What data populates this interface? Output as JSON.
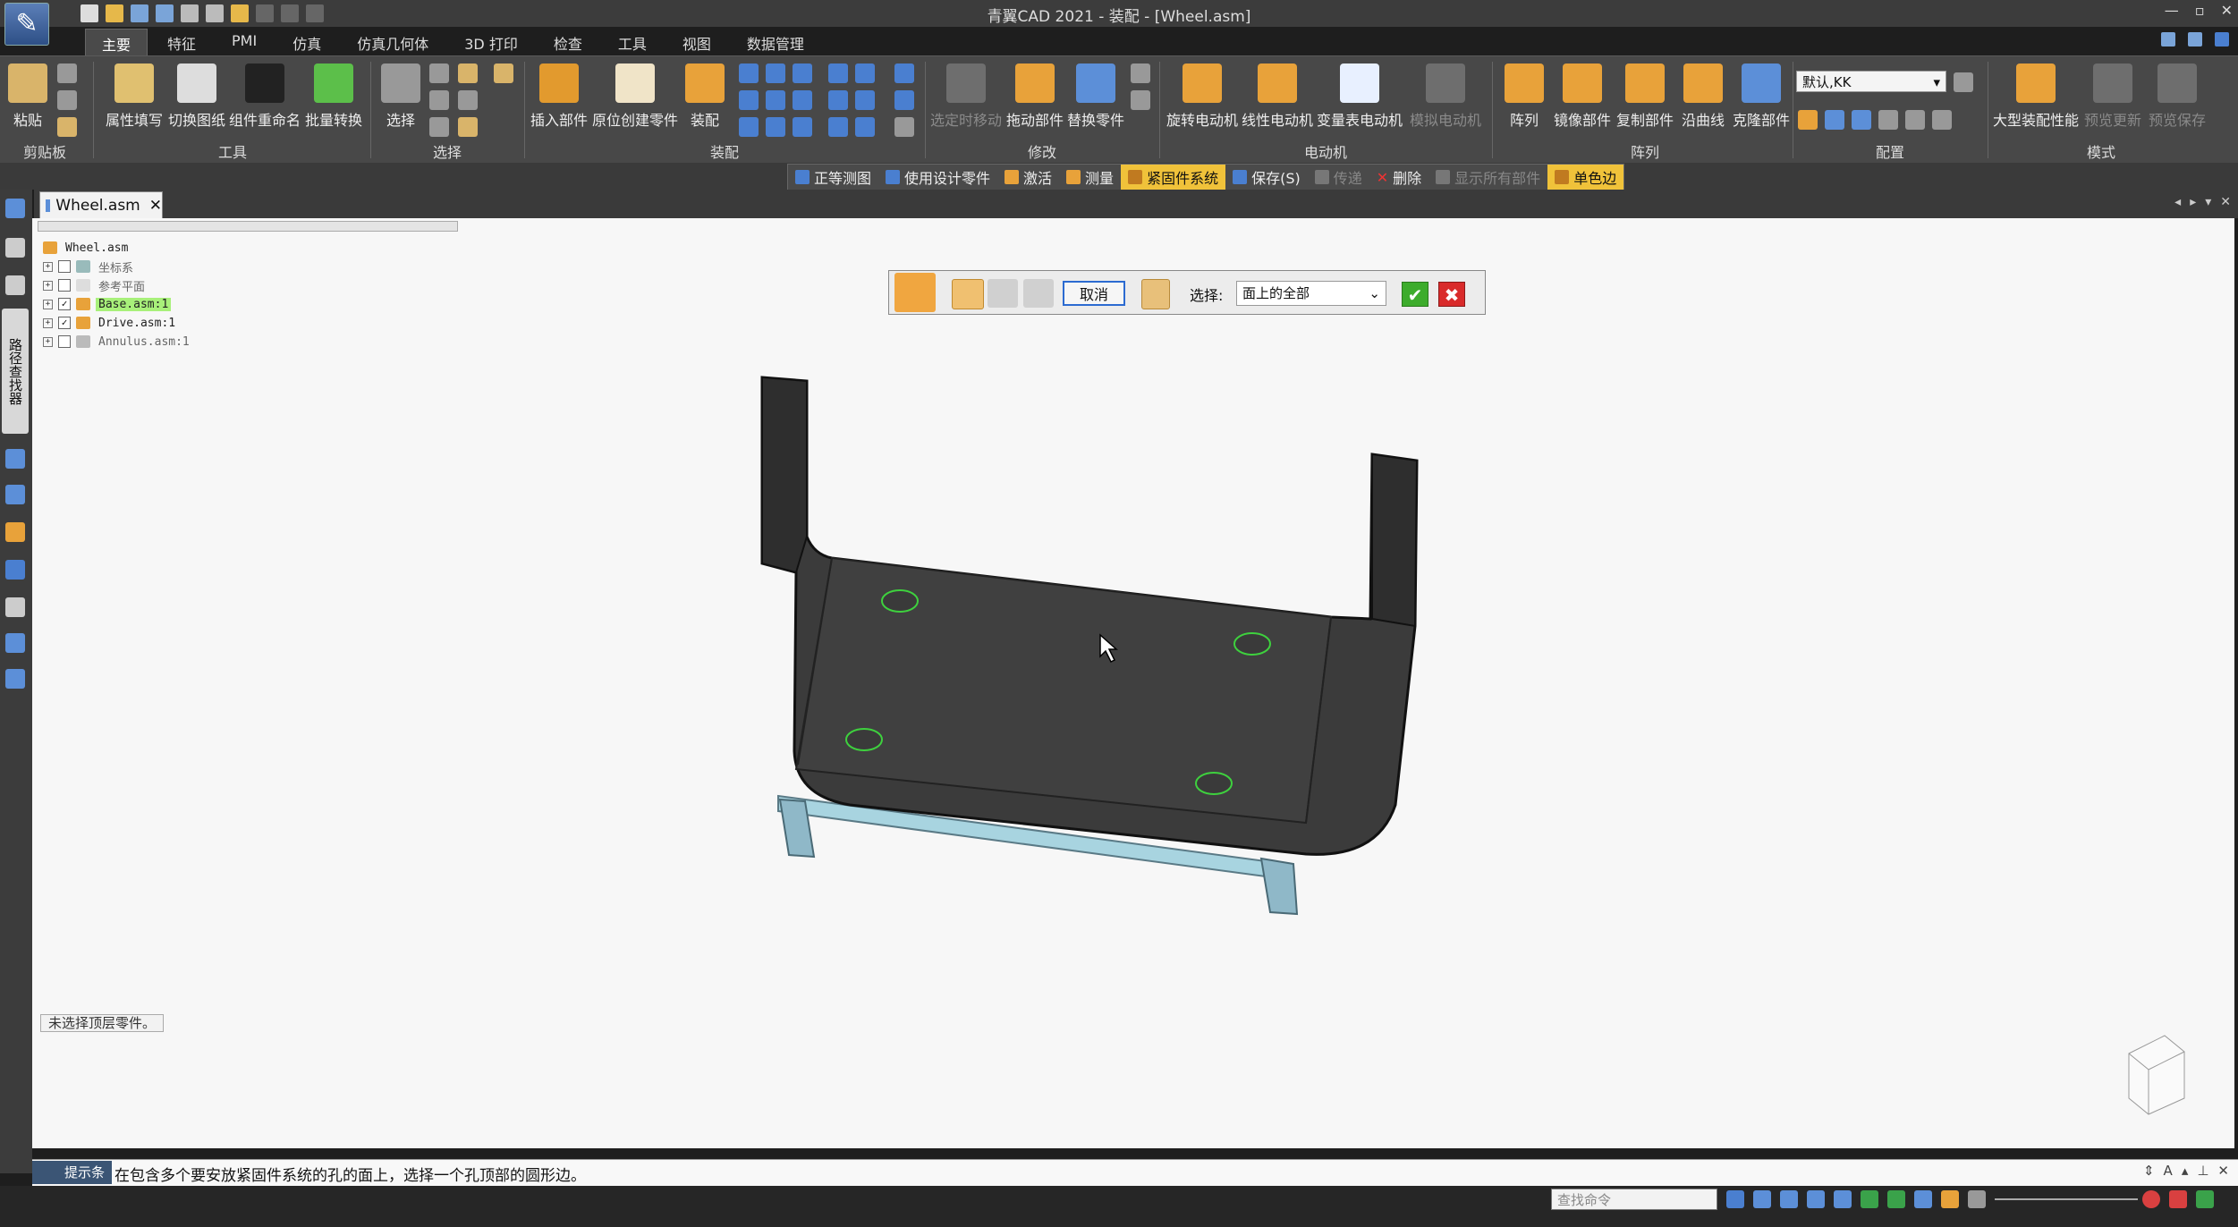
{
  "window": {
    "title": "青翼CAD 2021 - 装配 - [Wheel.asm]"
  },
  "ribbon_tabs": [
    "主要",
    "特征",
    "PMI",
    "仿真",
    "仿真几何体",
    "3D 打印",
    "检查",
    "工具",
    "视图",
    "数据管理"
  ],
  "ribbon": {
    "clipboard": {
      "paste": "粘贴",
      "group": "剪贴板"
    },
    "tools": {
      "prop_fill": "属性填写",
      "switch_drawing": "切换图纸",
      "rename_component": "组件重命名",
      "batch_convert": "批量转换",
      "group": "工具"
    },
    "select": {
      "select": "选择",
      "group": "选择"
    },
    "assembly": {
      "insert_part": "插入部件",
      "create_in_place": "原位创建零件",
      "assemble": "装配",
      "group": "装配"
    },
    "modify": {
      "constrained_move": "选定时移动",
      "drag_part": "拖动部件",
      "replace_part": "替换零件",
      "group": "修改"
    },
    "motor": {
      "rotary_motor": "旋转电动机",
      "linear_motor": "线性电动机",
      "variable_table_motor": "变量表电动机",
      "simulate_motor": "模拟电动机",
      "group": "电动机"
    },
    "pattern": {
      "pattern": "阵列",
      "mirror_part": "镜像部件",
      "copy_part": "复制部件",
      "along_curve": "沿曲线",
      "clone_part": "克隆部件",
      "group": "阵列"
    },
    "config": {
      "value": "默认,KK",
      "group": "配置"
    },
    "mode": {
      "large_assembly": "大型装配性能",
      "preview_update": "预览更新",
      "preview_save": "预览保存",
      "group": "模式"
    }
  },
  "command_bar": {
    "iso_view": "正等测图",
    "use_design_part": "使用设计零件",
    "activate": "激活",
    "measure": "测量",
    "fastener_system": "紧固件系统",
    "save": "保存(S)",
    "transfer": "传递",
    "delete": "删除",
    "show_all": "显示所有部件",
    "single_color": "单色边"
  },
  "document_tab": {
    "label": "Wheel.asm"
  },
  "left_bar": {
    "vertical_tab": "路径查找器"
  },
  "tree": [
    {
      "label": "Wheel.asm",
      "checked": null,
      "style": "normal"
    },
    {
      "label": "坐标系",
      "checked": false,
      "style": "gray"
    },
    {
      "label": "参考平面",
      "checked": false,
      "style": "gray"
    },
    {
      "label": "Base.asm:1",
      "checked": true,
      "style": "green"
    },
    {
      "label": "Drive.asm:1",
      "checked": true,
      "style": "normal"
    },
    {
      "label": "Annulus.asm:1",
      "checked": false,
      "style": "gray"
    }
  ],
  "fastener_dialog": {
    "cancel": "取消",
    "select_label": "选择:",
    "select_value": "面上的全部",
    "ok_symbol": "✔",
    "close_symbol": "✖"
  },
  "viewport": {
    "status_tag": "未选择顶层零件。"
  },
  "prompt": {
    "label": "提示条",
    "text": "在包含多个要安放紧固件系统的孔的面上，选择一个孔顶部的圆形边。"
  },
  "status_bar": {
    "search_placeholder": "查找命令"
  },
  "colors": {
    "accent": "#f0c23a",
    "model_body": "#3b3b3b",
    "hole_highlight": "#3ed13e",
    "sub_part": "#a8d4e0"
  }
}
